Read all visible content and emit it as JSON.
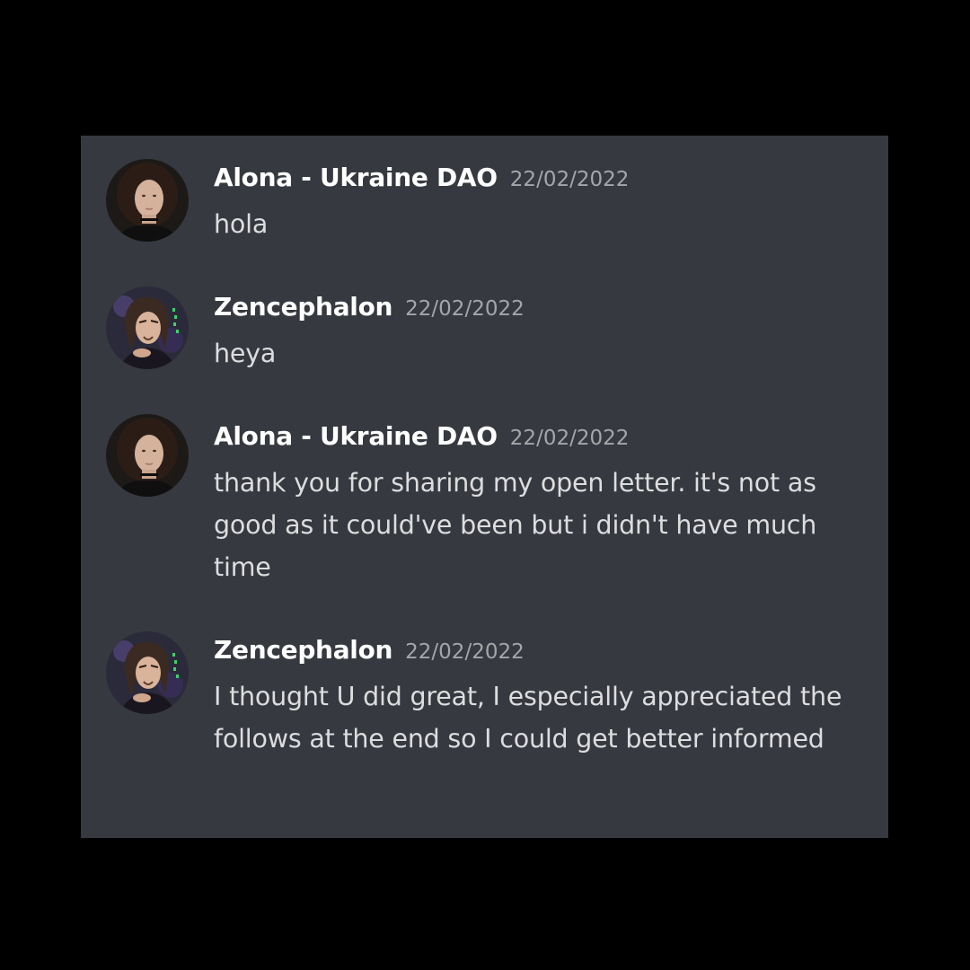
{
  "colors": {
    "background": "#000000",
    "panel": "#36393f",
    "username": "#ffffff",
    "timestamp": "#a3a6aa",
    "text": "#dcddde"
  },
  "messages": [
    {
      "username": "Alona - Ukraine DAO",
      "timestamp": "22/02/2022",
      "text": "hola",
      "avatar": "alona-avatar-icon"
    },
    {
      "username": "Zencephalon",
      "timestamp": "22/02/2022",
      "text": "heya",
      "avatar": "zencephalon-avatar-icon"
    },
    {
      "username": "Alona - Ukraine DAO",
      "timestamp": "22/02/2022",
      "text": "thank you for sharing my open letter. it's not as good as it could've been but i didn't have much time",
      "avatar": "alona-avatar-icon"
    },
    {
      "username": "Zencephalon",
      "timestamp": "22/02/2022",
      "text": "I thought U did great, I especially appreciated the follows at the end so I could get better informed",
      "avatar": "zencephalon-avatar-icon"
    }
  ]
}
